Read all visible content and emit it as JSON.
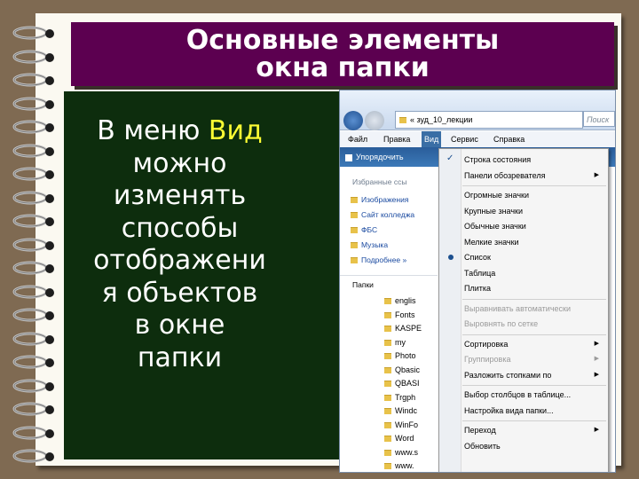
{
  "slide": {
    "title_line1": "Основные элементы",
    "title_line2": "окна папки",
    "body_lines": [
      {
        "text": "В меню ",
        "highlight": "Вид"
      },
      {
        "text": "можно"
      },
      {
        "text": "изменять"
      },
      {
        "text": "способы"
      },
      {
        "text": "отображени"
      },
      {
        "text": "я объектов"
      },
      {
        "text": "в окне"
      },
      {
        "text": "папки"
      }
    ],
    "highlight_color": "#ffff33",
    "banner_color": "#5c0050",
    "panel_color": "#0d2d0d"
  },
  "explorer": {
    "address": "« зуд_10_лекции",
    "search_placeholder": "Поиск",
    "menu": [
      "Файл",
      "Правка",
      "Вид",
      "Сервис",
      "Справка"
    ],
    "active_menu": "Вид",
    "toolbar_label": "Упорядочить",
    "favorites_header": "Избранные ссы",
    "favorites": [
      "Изображения",
      "Сайт колледжа",
      "ФБС",
      "Музыка",
      "Подробнее »"
    ],
    "folders_header": "Папки",
    "files": [
      "englis",
      "Fonts",
      "KASPE",
      "my",
      "Photo",
      "Qbasic",
      "QBASI",
      "Trgph",
      "Windc",
      "WinFo",
      "Word",
      "www.s",
      "www."
    ],
    "view_menu": [
      {
        "label": "Строка состояния",
        "checked": true
      },
      {
        "label": "Панели обозревателя",
        "submenu": true
      },
      {
        "sep": true
      },
      {
        "label": "Огромные значки"
      },
      {
        "label": "Крупные значки"
      },
      {
        "label": "Обычные значки"
      },
      {
        "label": "Мелкие значки"
      },
      {
        "label": "Список",
        "bullet": true
      },
      {
        "label": "Таблица"
      },
      {
        "label": "Плитка"
      },
      {
        "sep": true
      },
      {
        "label": "Выравнивать автоматически",
        "disabled": true
      },
      {
        "label": "Выровнять по сетке",
        "disabled": true
      },
      {
        "sep": true
      },
      {
        "label": "Сортировка",
        "submenu": true
      },
      {
        "label": "Группировка",
        "submenu": true,
        "disabled": true
      },
      {
        "label": "Разложить стопками по",
        "submenu": true
      },
      {
        "sep": true
      },
      {
        "label": "Выбор столбцов в таблице..."
      },
      {
        "label": "Настройка вида папки..."
      },
      {
        "sep": true
      },
      {
        "label": "Переход",
        "submenu": true
      },
      {
        "label": "Обновить"
      }
    ]
  }
}
